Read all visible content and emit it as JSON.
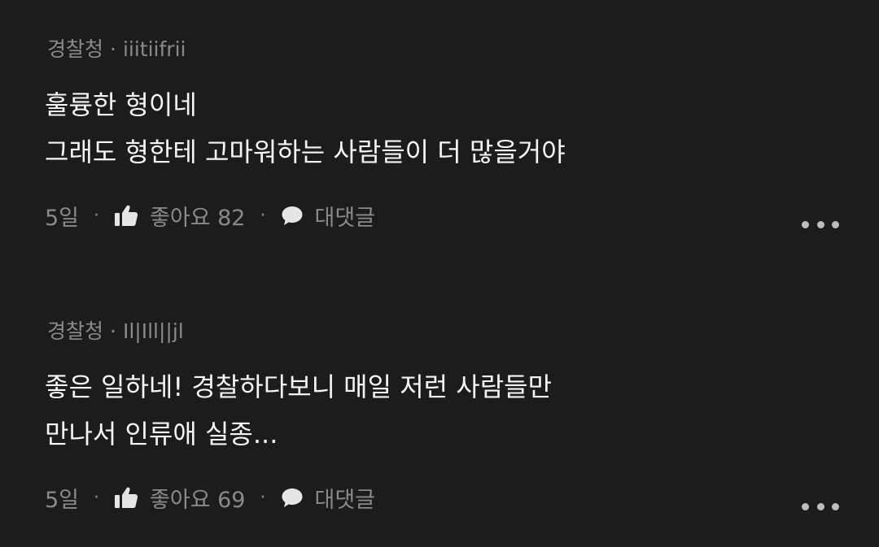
{
  "comments": [
    {
      "source": "경찰청",
      "separator": "·",
      "user": "iiitiifrii",
      "lines": [
        "훌륭한 형이네",
        "그래도 형한테 고마워하는 사람들이 더 많을거야"
      ],
      "time": "5일",
      "like_label": "좋아요 82",
      "reply_label": "대댓글",
      "dot": "·",
      "like_icon": "thumbs-up-icon",
      "reply_icon": "speech-bubble-icon",
      "more_icon": "more-options-icon"
    },
    {
      "source": "경찰청",
      "separator": "·",
      "user": "Il|Ill||jl",
      "lines": [
        "좋은 일하네! 경찰하다보니 매일 저런 사람들만",
        "만나서 인류애 실종..."
      ],
      "time": "5일",
      "like_label": "좋아요 69",
      "reply_label": "대댓글",
      "dot": "·",
      "like_icon": "thumbs-up-icon",
      "reply_icon": "speech-bubble-icon",
      "more_icon": "more-options-icon"
    }
  ],
  "colors": {
    "background": "#1c1c1c",
    "primary_text": "#f5f5f5",
    "secondary_text": "#8a8a8a"
  }
}
